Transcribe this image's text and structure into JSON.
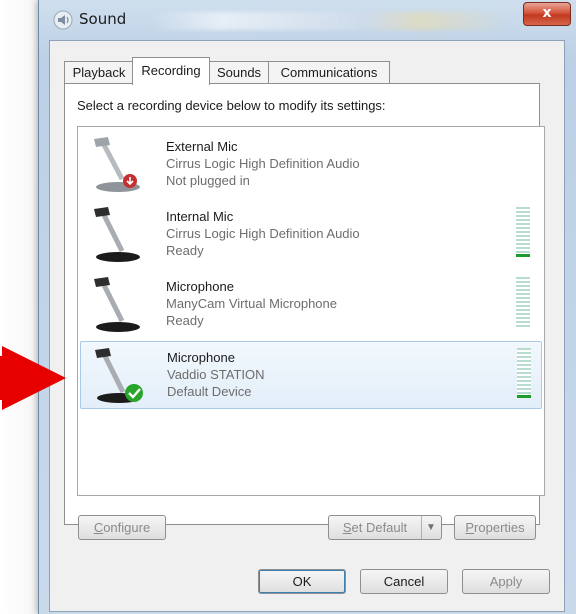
{
  "window": {
    "title": "Sound",
    "close_label": "x"
  },
  "tabs": [
    {
      "label": "Playback"
    },
    {
      "label": "Recording"
    },
    {
      "label": "Sounds"
    },
    {
      "label": "Communications"
    }
  ],
  "instruction": "Select a recording device below to modify its settings:",
  "devices": [
    {
      "name": "External Mic",
      "driver": "Cirrus Logic High Definition Audio",
      "status": "Not plugged in",
      "icon": "microphone-unplugged-icon",
      "level": null
    },
    {
      "name": "Internal Mic",
      "driver": "Cirrus Logic High Definition Audio",
      "status": "Ready",
      "icon": "microphone-icon",
      "level": 0.06
    },
    {
      "name": "Microphone",
      "driver": "ManyCam Virtual Microphone",
      "status": "Ready",
      "icon": "microphone-icon",
      "level": 0.0
    },
    {
      "name": "Microphone",
      "driver": "Vaddio STATION",
      "status": "Default Device",
      "icon": "microphone-default-icon",
      "level": 0.06
    }
  ],
  "buttons": {
    "configure": {
      "first": "C",
      "rest": "onfigure"
    },
    "set_default": {
      "first": "S",
      "rest": "et Default"
    },
    "properties": {
      "first": "P",
      "rest": "roperties"
    },
    "ok": "OK",
    "cancel": "Cancel",
    "apply": "Apply"
  },
  "colors": {
    "accent_selection": "#e2eef9",
    "meter_green": "#1f9b2b",
    "callout_red": "#e60000"
  }
}
